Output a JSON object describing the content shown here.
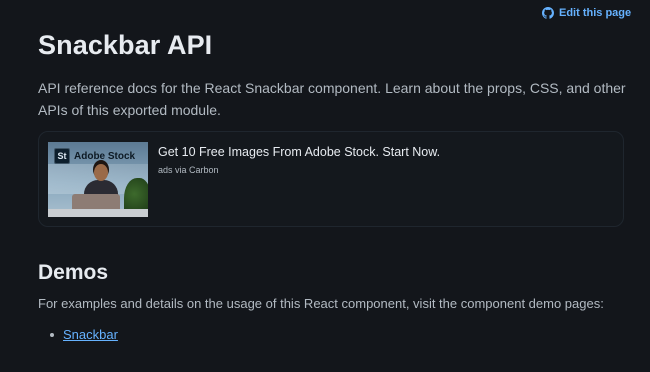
{
  "header": {
    "edit_link_label": "Edit this page",
    "edit_link_icon": "github-icon",
    "link_color": "#66b2ff"
  },
  "page": {
    "title": "Snackbar API",
    "description": "API reference docs for the React Snackbar component. Learn about the props, CSS, and other APIs of this exported module."
  },
  "ad": {
    "image_logo_mark": "St",
    "image_logo_text": "Adobe Stock",
    "headline": "Get 10 Free Images From Adobe Stock. Start Now.",
    "via": "ads via Carbon"
  },
  "demos": {
    "title": "Demos",
    "description": "For examples and details on the usage of this React component, visit the component demo pages:",
    "links": [
      {
        "label": "Snackbar"
      }
    ]
  },
  "colors": {
    "background": "#13161b",
    "text_primary": "#e7ebf0",
    "text_secondary": "#b2bac2"
  }
}
